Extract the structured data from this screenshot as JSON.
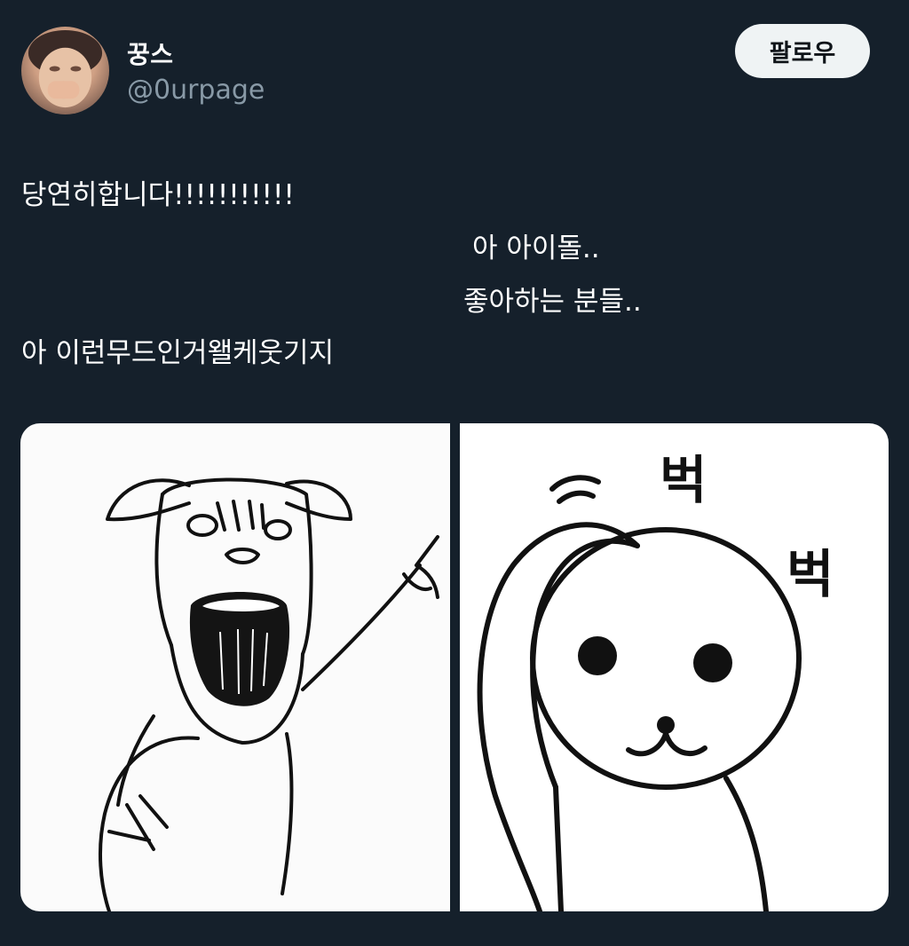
{
  "author": {
    "display_name": "꿍스",
    "handle": "@0urpage",
    "avatar_icon": "profile-photo"
  },
  "follow_button": {
    "label": "팔로우"
  },
  "tweet": {
    "lines": [
      "당연히합니다!!!!!!!!!!!",
      "아 아이돌..",
      "좋아하는 분들..",
      "아 이런무드인거왤케웃기지"
    ]
  },
  "media": {
    "images": [
      {
        "icon": "shouting-dog-pointing-drawing"
      },
      {
        "icon": "bear-tapping-head-drawing",
        "text": [
          "벅",
          "벅"
        ]
      }
    ]
  },
  "colors": {
    "background": "#15202b",
    "handle": "#8899a6",
    "button_bg": "#eff3f4",
    "button_text": "#0f1419"
  }
}
